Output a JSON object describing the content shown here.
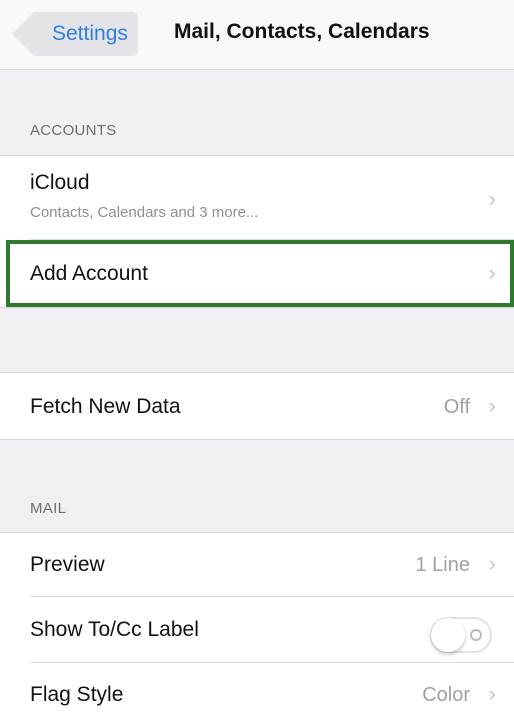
{
  "navbar": {
    "back_label": "Settings",
    "title": "Mail, Contacts, Calendars"
  },
  "accounts_section": {
    "header": "ACCOUNTS",
    "icloud_label": "iCloud",
    "icloud_sub": "Contacts, Calendars and 3 more...",
    "add_account_label": "Add Account"
  },
  "fetch": {
    "label": "Fetch New Data",
    "value": "Off"
  },
  "mail_section": {
    "header": "MAIL",
    "preview_label": "Preview",
    "preview_value": "1 Line",
    "show_tocc_label": "Show To/Cc Label",
    "show_tocc_on": false,
    "flag_style_label": "Flag Style",
    "flag_style_value": "Color"
  },
  "colors": {
    "accent": "#2f7fe3",
    "highlight": "#2f7a2f",
    "background": "#efeff4"
  },
  "icons": {
    "chevron": "chevron-right-icon",
    "back": "chevron-left-icon"
  }
}
